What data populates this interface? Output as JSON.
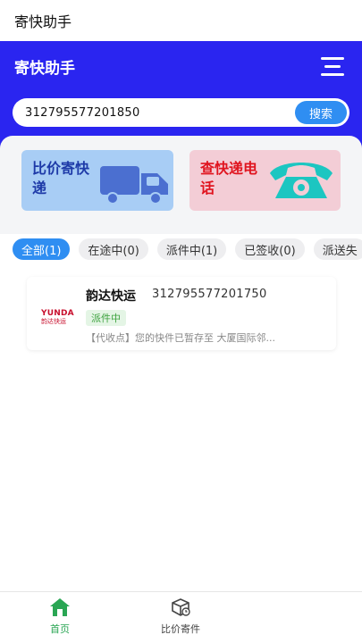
{
  "status_bar": {
    "title": "寄快助手"
  },
  "header": {
    "title": "寄快助手",
    "menu_icon": "scan-menu-icon"
  },
  "search": {
    "value": "312795577201850",
    "button_label": "搜索"
  },
  "cards": [
    {
      "label": "比价寄快递",
      "icon": "truck-icon",
      "color": "#a8cdf5"
    },
    {
      "label": "查快递电话",
      "icon": "telephone-icon",
      "color": "#f3cdd6"
    }
  ],
  "tabs": [
    {
      "label": "全部(1)",
      "active": true
    },
    {
      "label": "在途中(0)"
    },
    {
      "label": "派件中(1)"
    },
    {
      "label": "已签收(0)"
    },
    {
      "label": "派送失"
    }
  ],
  "parcels": [
    {
      "logo_top": "YUNDA",
      "logo_bottom": "韵达快运",
      "carrier": "韵达快运",
      "tracking_no": "312795577201750",
      "status": "派件中",
      "latest": "【代收点】您的快件已暂存至 大厦国际邻..."
    }
  ],
  "tabbar": [
    {
      "label": "首页",
      "icon": "home-icon",
      "active": true,
      "color": "#2aa654"
    },
    {
      "label": "比价寄件",
      "icon": "box-icon"
    }
  ],
  "colors": {
    "header": "#2a25f0",
    "accent": "#2f8ef2"
  }
}
